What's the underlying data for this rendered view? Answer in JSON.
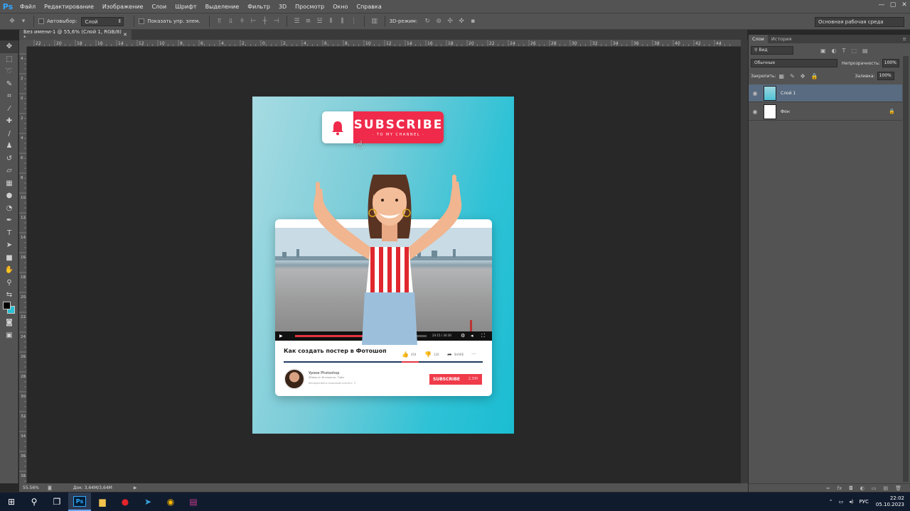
{
  "app": {
    "logo": "Ps"
  },
  "menu": [
    "Файл",
    "Редактирование",
    "Изображение",
    "Слои",
    "Шрифт",
    "Выделение",
    "Фильтр",
    "3D",
    "Просмотр",
    "Окно",
    "Справка"
  ],
  "window_controls": [
    "—",
    "▢",
    "✕"
  ],
  "options": {
    "autoselect_label": "Автовыбор:",
    "autoselect_value": "Слой",
    "show_transform_label": "Показать упр. элем.",
    "mode_3d_label": "3D-режим:",
    "workspace": "Основная рабочая среда"
  },
  "document": {
    "tab_title": "Без имени-1 @ 55,6% (Слой 1, RGB/8) *",
    "close": "✕"
  },
  "rulers": {
    "h_labels": [
      "22",
      "20",
      "18",
      "16",
      "14",
      "12",
      "10",
      "8",
      "6",
      "4",
      "2",
      "0",
      "2",
      "4",
      "6",
      "8",
      "10",
      "12",
      "14",
      "16",
      "18",
      "20",
      "22",
      "24",
      "26",
      "28",
      "30",
      "32",
      "34",
      "36",
      "38",
      "40",
      "42",
      "44"
    ],
    "v_labels": [
      "4",
      "2",
      "0",
      "2",
      "4",
      "6",
      "8",
      "10",
      "12",
      "14",
      "16",
      "18",
      "20",
      "22",
      "24",
      "26",
      "28",
      "30",
      "32",
      "34",
      "36",
      "38",
      "40"
    ]
  },
  "poster": {
    "subscribe_text": "SUBSCRIBE",
    "subscribe_small": "· TO MY CHANNEL ·",
    "video_title": "Как создать постер в Фотошоп",
    "likes": "454",
    "dislikes": "120",
    "share": "SHARE",
    "more": "...",
    "time": "24:15 / 34:30",
    "progress": 0.65,
    "channel_name": "Уроки Photoshop",
    "channel_sub": "@fotos.ch  Интересно, Тайм",
    "channel_sub2": "Интересный и полезный контент: 3",
    "card_subscribe": "SUBSCRIBE",
    "card_count": "2,5M"
  },
  "panels": {
    "tabs": [
      "Слои",
      "История"
    ],
    "search_kind": "Вид",
    "blend_mode": "Обычные",
    "opacity_label": "Непрозрачность:",
    "opacity": "100%",
    "lock_label": "Закрепить:",
    "fill_label": "Заливка:",
    "fill": "100%",
    "layers": [
      {
        "name": "Слой 1"
      },
      {
        "name": "Фон"
      }
    ],
    "footer_icons": [
      "∞",
      "fx",
      "◘",
      "◐",
      "▭",
      "▤",
      "🗑"
    ]
  },
  "status": {
    "zoom": "55.56%",
    "doc": "Док: 3,64M/3,64M"
  },
  "taskbar": {
    "lang": "РУС",
    "time": "22:02",
    "date": "05.10.2023"
  },
  "colors": {
    "accent_red": "#ef2a4a",
    "poster_cyan": "#1bbdd2",
    "selected_layer": "#596b80"
  }
}
